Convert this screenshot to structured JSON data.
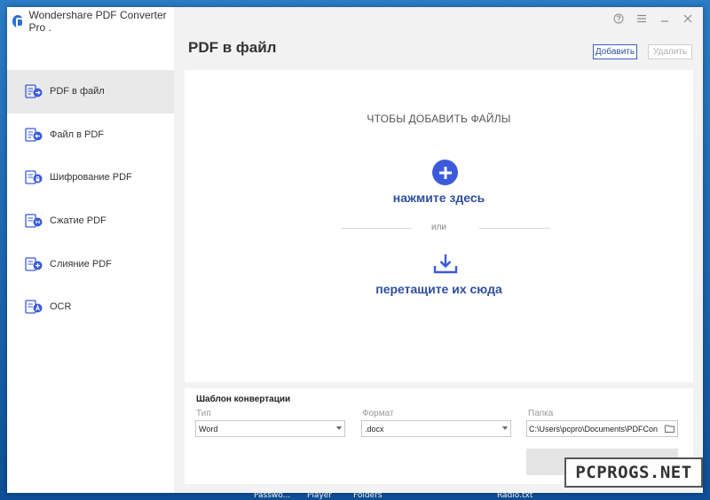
{
  "app": {
    "title": "Wondershare PDF Converter Pro .",
    "controls": {
      "help": "?",
      "menu": "≡",
      "minimize": "—",
      "close": "✕"
    }
  },
  "sidebar": {
    "items": [
      {
        "label": "PDF в файл",
        "icon": "pdf-to-file-icon",
        "active": true
      },
      {
        "label": "Файл в PDF",
        "icon": "file-to-pdf-icon",
        "active": false
      },
      {
        "label": "Шифрование PDF",
        "icon": "encrypt-pdf-icon",
        "active": false
      },
      {
        "label": "Сжатие PDF",
        "icon": "compress-pdf-icon",
        "active": false
      },
      {
        "label": "Слияние PDF",
        "icon": "merge-pdf-icon",
        "active": false
      },
      {
        "label": "OCR",
        "icon": "ocr-icon",
        "active": false
      }
    ]
  },
  "header": {
    "title": "PDF в файл",
    "add_label": "Добавить",
    "delete_label": "Удалить"
  },
  "dropzone": {
    "heading": "ЧТОБЫ ДОБАВИТЬ ФАЙЛЫ",
    "click_label": "нажмите здесь",
    "or_label": "или",
    "drag_label": "перетащите их сюда"
  },
  "template": {
    "title": "Шаблон конвертации",
    "type_label": "Тип",
    "type_value": "Word",
    "format_label": "Формат",
    "format_value": ".docx",
    "folder_label": "Папка",
    "folder_value": "C:\\Users\\pcpro\\Documents\\PDFCon"
  },
  "desktop": {
    "taskbar_labels": [
      "Passwo...",
      "Player",
      "Folders",
      "Radio.txt"
    ]
  },
  "watermark": "PCPROGS.NET",
  "colors": {
    "accent": "#3b5bdb",
    "accent_text": "#2f4f9e",
    "sidebar_active": "#e9e9e9"
  }
}
